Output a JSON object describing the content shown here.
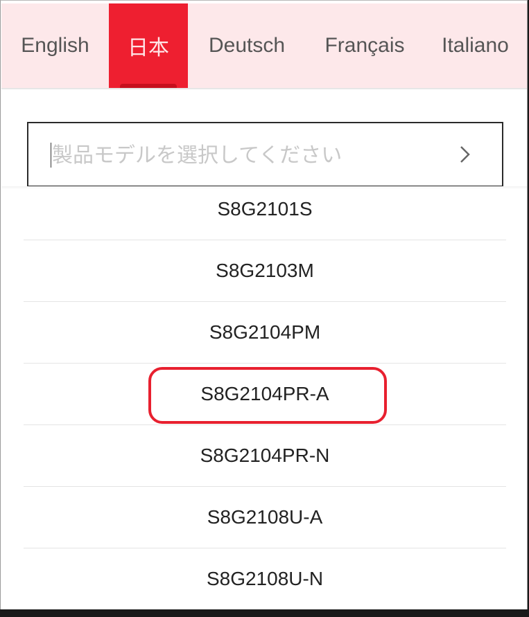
{
  "language_tabs": [
    {
      "label": "English",
      "active": false
    },
    {
      "label": "日本",
      "active": true
    },
    {
      "label": "Deutsch",
      "active": false
    },
    {
      "label": "Français",
      "active": false
    },
    {
      "label": "Italiano",
      "active": false
    }
  ],
  "search": {
    "placeholder": "製品モデルを選択してください",
    "value": "",
    "submit_icon": "chevron-right-icon"
  },
  "models": [
    "S8G2101S",
    "S8G2103M",
    "S8G2104PM",
    "S8G2104PR-A",
    "S8G2104PR-N",
    "S8G2108U-A",
    "S8G2108U-N"
  ],
  "highlighted_model": "S8G2104PR-A",
  "colors": {
    "accent": "#ee1f30",
    "tab_bar_bg": "#fde8ea",
    "highlight_border": "#e8202f"
  }
}
